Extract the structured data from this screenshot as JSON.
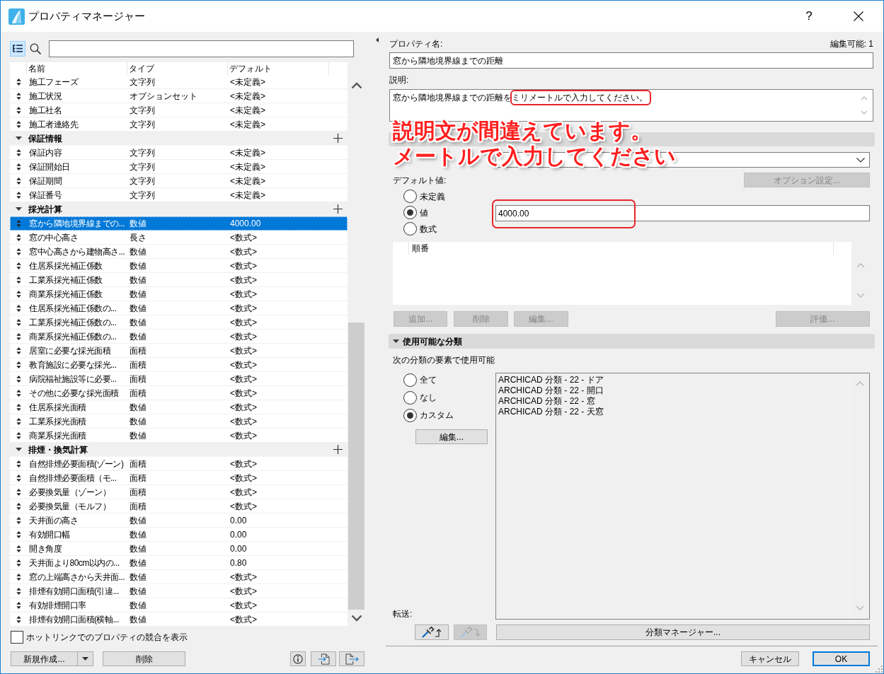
{
  "window": {
    "title": "プロパティマネージャー",
    "help": "?"
  },
  "left_panel": {
    "table": {
      "columns": [
        "名前",
        "タイプ",
        "デフォルト"
      ],
      "groups": [
        {
          "children": [
            {
              "name": "施工フェーズ",
              "type": "文字列",
              "default": "<未定義>",
              "selected": false
            },
            {
              "name": "施工状況",
              "type": "オプションセット",
              "default": "<未定義>",
              "selected": false
            },
            {
              "name": "施工社名",
              "type": "文字列",
              "default": "<未定義>",
              "selected": false
            },
            {
              "name": "施工者連絡先",
              "type": "文字列",
              "default": "<未定義>",
              "selected": false
            }
          ]
        },
        {
          "name": "保証情報",
          "expanded": true,
          "children": [
            {
              "name": "保証内容",
              "type": "文字列",
              "default": "<未定義>",
              "selected": false
            },
            {
              "name": "保証開始日",
              "type": "文字列",
              "default": "<未定義>",
              "selected": false
            },
            {
              "name": "保証期間",
              "type": "文字列",
              "default": "<未定義>",
              "selected": false
            },
            {
              "name": "保証番号",
              "type": "文字列",
              "default": "<未定義>",
              "selected": false
            }
          ]
        },
        {
          "name": "採光計算",
          "expanded": true,
          "children": [
            {
              "name": "窓から隣地境界線までの...",
              "type": "数値",
              "default": "4000.00",
              "selected": true
            },
            {
              "name": "窓の中心高さ",
              "type": "長さ",
              "default": "<数式>",
              "selected": false
            },
            {
              "name": "窓中心高さから建物高さ...",
              "type": "数値",
              "default": "<数式>",
              "selected": false
            },
            {
              "name": "住居系採光補正係数",
              "type": "数値",
              "default": "<数式>",
              "selected": false
            },
            {
              "name": "工業系採光補正係数",
              "type": "数値",
              "default": "<数式>",
              "selected": false
            },
            {
              "name": "商業系採光補正係数",
              "type": "数値",
              "default": "<数式>",
              "selected": false
            },
            {
              "name": "住居系採光補正係数の...",
              "type": "数値",
              "default": "<数式>",
              "selected": false
            },
            {
              "name": "工業系採光補正係数の...",
              "type": "数値",
              "default": "<数式>",
              "selected": false
            },
            {
              "name": "商業系採光補正係数の...",
              "type": "数値",
              "default": "<数式>",
              "selected": false
            },
            {
              "name": "居室に必要な採光面積",
              "type": "面積",
              "default": "<数式>",
              "selected": false
            },
            {
              "name": "教育施設に必要な採光...",
              "type": "面積",
              "default": "<数式>",
              "selected": false
            },
            {
              "name": "病院福祉施設等に必要...",
              "type": "面積",
              "default": "<数式>",
              "selected": false
            },
            {
              "name": "その他に必要な採光面積",
              "type": "面積",
              "default": "<数式>",
              "selected": false
            },
            {
              "name": "住居系採光面積",
              "type": "数値",
              "default": "<数式>",
              "selected": false
            },
            {
              "name": "工業系採光面積",
              "type": "数値",
              "default": "<数式>",
              "selected": false
            },
            {
              "name": "商業系採光面積",
              "type": "数値",
              "default": "<数式>",
              "selected": false
            }
          ]
        },
        {
          "name": "排煙・換気計算",
          "expanded": true,
          "children": [
            {
              "name": "自然排煙必要面積(ゾーン)",
              "type": "面積",
              "default": "<数式>",
              "selected": false
            },
            {
              "name": "自然排煙必要面積（モ...",
              "type": "面積",
              "default": "<数式>",
              "selected": false
            },
            {
              "name": "必要換気量（ゾーン）",
              "type": "面積",
              "default": "<数式>",
              "selected": false
            },
            {
              "name": "必要換気量（モルフ）",
              "type": "面積",
              "default": "<数式>",
              "selected": false
            },
            {
              "name": "天井面の高さ",
              "type": "数値",
              "default": "0.00",
              "selected": false
            },
            {
              "name": "有効開口幅",
              "type": "数値",
              "default": "0.00",
              "selected": false
            },
            {
              "name": "開き角度",
              "type": "数値",
              "default": "0.00",
              "selected": false
            },
            {
              "name": "天井面より80cm以内の...",
              "type": "数値",
              "default": "0.80",
              "selected": false
            },
            {
              "name": "窓の上端高さから天井面...",
              "type": "数値",
              "default": "<数式>",
              "selected": false
            },
            {
              "name": "排煙有効開口面積(引違...",
              "type": "数値",
              "default": "<数式>",
              "selected": false
            },
            {
              "name": "有効排煙開口率",
              "type": "数値",
              "default": "<数式>",
              "selected": false
            },
            {
              "name": "排煙有効開口面積(横軸...",
              "type": "数値",
              "default": "<数式>",
              "selected": false
            }
          ]
        }
      ]
    },
    "hotlink": {
      "label": "ホットリンクでのプロパティの競合を表示",
      "checked": false
    },
    "new_button": "新規作成...",
    "delete_button": "削除"
  },
  "detail_panel": {
    "name_label": "プロパティ名:",
    "editable": "編集可能: 1",
    "name_value": "窓から隣地境界線までの距離",
    "description_label": "説明:",
    "description": "窓から隣地境界線までの距離をミリメートルで入力してください。",
    "default_label": "デフォルト値:",
    "option_button": {
      "label": "オプション設定...",
      "disabled": true
    },
    "default_options": [
      {
        "label": "未定義",
        "selected": false
      },
      {
        "label": "値",
        "selected": true
      },
      {
        "label": "数式",
        "selected": false
      }
    ],
    "default_value": "4000.00",
    "list_columns": [
      "順番"
    ],
    "list_buttons": [
      {
        "label": "追加...",
        "disabled": true
      },
      {
        "label": "削除",
        "disabled": true
      },
      {
        "label": "編集...",
        "disabled": true
      },
      {
        "label": "評価...",
        "disabled": true
      }
    ],
    "classification": {
      "title": "使用可能な分類",
      "expanded": true,
      "caption": "次の分類の要素で使用可能",
      "options": [
        {
          "label": "全て",
          "selected": false
        },
        {
          "label": "なし",
          "selected": false
        },
        {
          "label": "カスタム",
          "selected": true
        }
      ],
      "edit_button": "編集...",
      "items": [
        "ARCHICAD 分類 - 22 - ドア",
        "ARCHICAD 分類 - 22 - 開口",
        "ARCHICAD 分類 - 22 - 窓",
        "ARCHICAD 分類 - 22 - 天窓"
      ]
    },
    "transfer_label": "転送:",
    "transfer_buttons": [
      {
        "kind": "up",
        "disabled": false
      },
      {
        "kind": "down",
        "disabled": true
      }
    ],
    "manager_button": "分類マネージャー..."
  },
  "dialog_buttons": [
    {
      "label": "キャンセル",
      "default": false
    },
    {
      "label": "OK",
      "default": true
    }
  ],
  "annotation": {
    "lines": [
      "説明文が間違えています。",
      "メートルで入力してください"
    ]
  }
}
